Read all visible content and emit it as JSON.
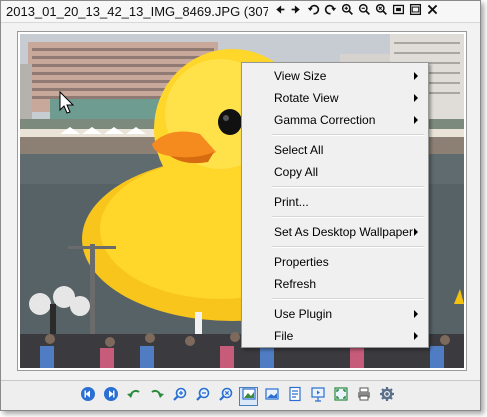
{
  "window": {
    "title": "2013_01_20_13_42_13_IMG_8469.JPG (307..."
  },
  "title_tools": [
    {
      "name": "previous-icon"
    },
    {
      "name": "next-icon"
    },
    {
      "name": "rotate-left-icon"
    },
    {
      "name": "rotate-right-icon"
    },
    {
      "name": "zoom-in-icon"
    },
    {
      "name": "zoom-out-icon"
    },
    {
      "name": "zoom-reset-icon"
    },
    {
      "name": "fit-window-icon"
    },
    {
      "name": "fullscreen-icon"
    },
    {
      "name": "close-icon"
    }
  ],
  "context_menu": {
    "items": [
      {
        "label": "View Size",
        "submenu": true
      },
      {
        "label": "Rotate View",
        "submenu": true
      },
      {
        "label": "Gamma Correction",
        "submenu": true
      },
      {
        "sep": true
      },
      {
        "label": "Select All",
        "submenu": false
      },
      {
        "label": "Copy All",
        "submenu": false
      },
      {
        "sep": true
      },
      {
        "label": "Print...",
        "submenu": false
      },
      {
        "sep": true
      },
      {
        "label": "Set As Desktop Wallpaper",
        "submenu": true
      },
      {
        "sep": true
      },
      {
        "label": "Properties",
        "submenu": false
      },
      {
        "label": "Refresh",
        "submenu": false
      },
      {
        "sep": true
      },
      {
        "label": "Use Plugin",
        "submenu": true
      },
      {
        "label": "File",
        "submenu": true
      }
    ]
  },
  "bottom_tools": [
    {
      "name": "previous-image-icon",
      "active": false
    },
    {
      "name": "next-image-icon",
      "active": false
    },
    {
      "name": "rotate-left-icon",
      "active": false
    },
    {
      "name": "rotate-right-icon",
      "active": false
    },
    {
      "name": "zoom-in-icon",
      "active": false
    },
    {
      "name": "zoom-out-icon",
      "active": false
    },
    {
      "name": "zoom-reset-icon",
      "active": false
    },
    {
      "name": "fit-image-icon",
      "active": true
    },
    {
      "name": "actual-size-icon",
      "active": false
    },
    {
      "name": "image-info-icon",
      "active": false
    },
    {
      "name": "slideshow-icon",
      "active": false
    },
    {
      "name": "fullscreen-icon",
      "active": false
    },
    {
      "name": "print-icon",
      "active": false
    },
    {
      "name": "settings-icon",
      "active": false
    }
  ],
  "colors": {
    "accent": "#1a5fb4",
    "duck_yellow": "#ffd21a",
    "beak_orange": "#f58a1f",
    "water": "#5f6b6f",
    "sky": "#c9ced3"
  }
}
